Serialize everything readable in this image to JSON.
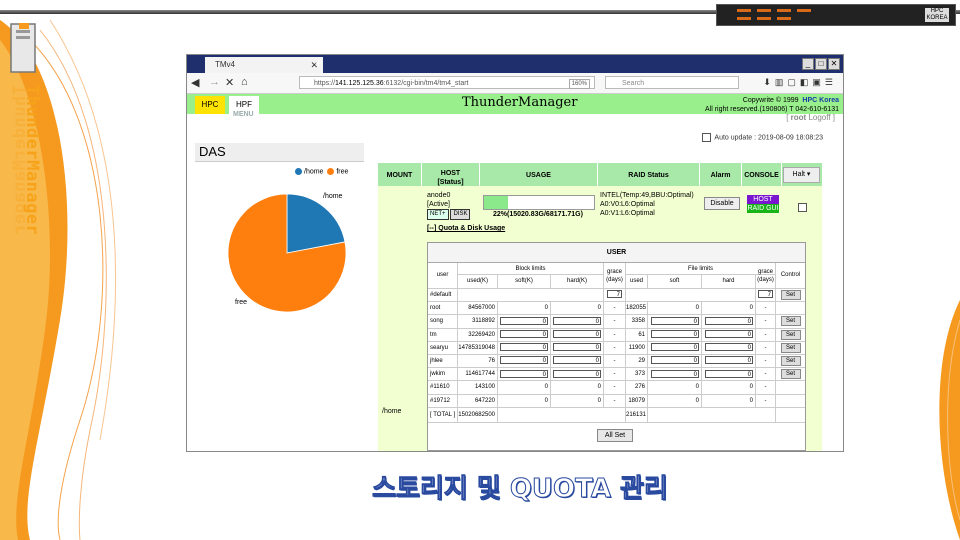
{
  "slide": {
    "brand_vertical": "ThunderManager",
    "caption": "스토리지 및 QUOTA 관리",
    "server_label": "HPC KOREA"
  },
  "browser": {
    "tab_title": "TMv4",
    "url_host": "141.125.125.36",
    "url_rest": ":6132/cgi-bin/tm4/tm4_start",
    "url_prefix": "https://",
    "zoom": "160%",
    "search_placeholder": "Search"
  },
  "app": {
    "tab_hpc": "HPC",
    "tab_hpf": "HPF",
    "menu_label": "MENU",
    "title": "ThunderManager",
    "copyright_line1": "Copywrite © 1999",
    "brand": "HPC Korea",
    "copyright_line2": "All right reserved.(190806) T 042-610-6131",
    "user": "root",
    "logoff": "Logoff",
    "auto_update_label": "Auto update : 2019-08-09 18:08:23",
    "section_title": "DAS"
  },
  "chart_data": {
    "type": "pie",
    "categories": [
      "/home",
      "free"
    ],
    "values": [
      22,
      78
    ],
    "colors": [
      "#1f77b4",
      "#ff7f0e"
    ],
    "legend": [
      "/home",
      "free"
    ],
    "legend_position": "top"
  },
  "das_table": {
    "headers": {
      "mount": "MOUNT",
      "host": "HOST",
      "host_sub": "[Status]",
      "usage": "USAGE",
      "raid": "RAID Status",
      "alarm": "Alarm",
      "console": "CONSOLE",
      "halt": "Halt"
    },
    "host_name": "anode0",
    "host_status": "[Active]",
    "btn_net": "NET+",
    "btn_disk": "DISK",
    "usage_text": "22%(15020.83G/68171.71G)",
    "usage_percent": 22,
    "raid_line1": "INTEL(Temp:49,BBU:Optimal)",
    "raid_line2": "A0:V0:L6:Optimal",
    "raid_line3": "A0:V1:L6:Optimal",
    "alarm_btn": "Disable",
    "console_host": "HOST",
    "console_raid": "RAID GUI",
    "quota_link": "[--] Quota & Disk Usage",
    "mount_value": "/home"
  },
  "quota": {
    "title": "USER",
    "col_user": "user",
    "block_limits": "Block limits",
    "file_limits": "File limits",
    "used_k": "used(K)",
    "soft_k": "soft(K)",
    "hard_k": "hard(K)",
    "grace": "grace (days)",
    "used": "used",
    "soft": "soft",
    "hard": "hard",
    "control": "Control",
    "default_label": "#default",
    "default_grace": "7",
    "set_label": "Set",
    "all_set_label": "All Set",
    "rows": [
      {
        "user": "root",
        "used": "84567000",
        "soft": "0",
        "hard": "0",
        "grace": "-",
        "fused": "182055",
        "fsoft": "0",
        "fhard": "0",
        "fgrace": "-",
        "editable": false
      },
      {
        "user": "song",
        "used": "3118892",
        "soft": "0",
        "hard": "0",
        "grace": "-",
        "fused": "3358",
        "fsoft": "0",
        "fhard": "0",
        "fgrace": "-",
        "editable": true
      },
      {
        "user": "tm",
        "used": "32269420",
        "soft": "0",
        "hard": "0",
        "grace": "-",
        "fused": "61",
        "fsoft": "0",
        "fhard": "0",
        "fgrace": "-",
        "editable": true
      },
      {
        "user": "searyu",
        "used": "14785319048",
        "soft": "0",
        "hard": "0",
        "grace": "-",
        "fused": "11900",
        "fsoft": "0",
        "fhard": "0",
        "fgrace": "-",
        "editable": true
      },
      {
        "user": "jhlee",
        "used": "76",
        "soft": "0",
        "hard": "0",
        "grace": "-",
        "fused": "29",
        "fsoft": "0",
        "fhard": "0",
        "fgrace": "-",
        "editable": true
      },
      {
        "user": "jwkim",
        "used": "114617744",
        "soft": "0",
        "hard": "0",
        "grace": "-",
        "fused": "373",
        "fsoft": "0",
        "fhard": "0",
        "fgrace": "-",
        "editable": true
      },
      {
        "user": "#11610",
        "used": "143100",
        "soft": "0",
        "hard": "0",
        "grace": "-",
        "fused": "276",
        "fsoft": "0",
        "fhard": "0",
        "fgrace": "-",
        "editable": false
      },
      {
        "user": "#19712",
        "used": "647220",
        "soft": "0",
        "hard": "0",
        "grace": "-",
        "fused": "18079",
        "fsoft": "0",
        "fhard": "0",
        "fgrace": "-",
        "editable": false
      }
    ],
    "total_label": "[ TOTAL ]",
    "total_used": "15020682500",
    "total_fused": "216131"
  }
}
